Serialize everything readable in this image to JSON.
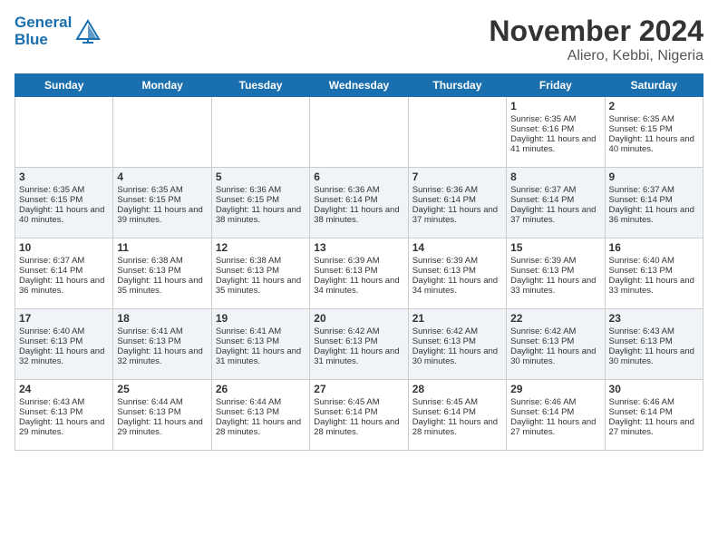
{
  "logo": {
    "line1": "General",
    "line2": "Blue"
  },
  "title": "November 2024",
  "subtitle": "Aliero, Kebbi, Nigeria",
  "days_of_week": [
    "Sunday",
    "Monday",
    "Tuesday",
    "Wednesday",
    "Thursday",
    "Friday",
    "Saturday"
  ],
  "weeks": [
    [
      {
        "day": "",
        "sunrise": "",
        "sunset": "",
        "daylight": ""
      },
      {
        "day": "",
        "sunrise": "",
        "sunset": "",
        "daylight": ""
      },
      {
        "day": "",
        "sunrise": "",
        "sunset": "",
        "daylight": ""
      },
      {
        "day": "",
        "sunrise": "",
        "sunset": "",
        "daylight": ""
      },
      {
        "day": "",
        "sunrise": "",
        "sunset": "",
        "daylight": ""
      },
      {
        "day": "1",
        "sunrise": "Sunrise: 6:35 AM",
        "sunset": "Sunset: 6:16 PM",
        "daylight": "Daylight: 11 hours and 41 minutes."
      },
      {
        "day": "2",
        "sunrise": "Sunrise: 6:35 AM",
        "sunset": "Sunset: 6:15 PM",
        "daylight": "Daylight: 11 hours and 40 minutes."
      }
    ],
    [
      {
        "day": "3",
        "sunrise": "Sunrise: 6:35 AM",
        "sunset": "Sunset: 6:15 PM",
        "daylight": "Daylight: 11 hours and 40 minutes."
      },
      {
        "day": "4",
        "sunrise": "Sunrise: 6:35 AM",
        "sunset": "Sunset: 6:15 PM",
        "daylight": "Daylight: 11 hours and 39 minutes."
      },
      {
        "day": "5",
        "sunrise": "Sunrise: 6:36 AM",
        "sunset": "Sunset: 6:15 PM",
        "daylight": "Daylight: 11 hours and 38 minutes."
      },
      {
        "day": "6",
        "sunrise": "Sunrise: 6:36 AM",
        "sunset": "Sunset: 6:14 PM",
        "daylight": "Daylight: 11 hours and 38 minutes."
      },
      {
        "day": "7",
        "sunrise": "Sunrise: 6:36 AM",
        "sunset": "Sunset: 6:14 PM",
        "daylight": "Daylight: 11 hours and 37 minutes."
      },
      {
        "day": "8",
        "sunrise": "Sunrise: 6:37 AM",
        "sunset": "Sunset: 6:14 PM",
        "daylight": "Daylight: 11 hours and 37 minutes."
      },
      {
        "day": "9",
        "sunrise": "Sunrise: 6:37 AM",
        "sunset": "Sunset: 6:14 PM",
        "daylight": "Daylight: 11 hours and 36 minutes."
      }
    ],
    [
      {
        "day": "10",
        "sunrise": "Sunrise: 6:37 AM",
        "sunset": "Sunset: 6:14 PM",
        "daylight": "Daylight: 11 hours and 36 minutes."
      },
      {
        "day": "11",
        "sunrise": "Sunrise: 6:38 AM",
        "sunset": "Sunset: 6:13 PM",
        "daylight": "Daylight: 11 hours and 35 minutes."
      },
      {
        "day": "12",
        "sunrise": "Sunrise: 6:38 AM",
        "sunset": "Sunset: 6:13 PM",
        "daylight": "Daylight: 11 hours and 35 minutes."
      },
      {
        "day": "13",
        "sunrise": "Sunrise: 6:39 AM",
        "sunset": "Sunset: 6:13 PM",
        "daylight": "Daylight: 11 hours and 34 minutes."
      },
      {
        "day": "14",
        "sunrise": "Sunrise: 6:39 AM",
        "sunset": "Sunset: 6:13 PM",
        "daylight": "Daylight: 11 hours and 34 minutes."
      },
      {
        "day": "15",
        "sunrise": "Sunrise: 6:39 AM",
        "sunset": "Sunset: 6:13 PM",
        "daylight": "Daylight: 11 hours and 33 minutes."
      },
      {
        "day": "16",
        "sunrise": "Sunrise: 6:40 AM",
        "sunset": "Sunset: 6:13 PM",
        "daylight": "Daylight: 11 hours and 33 minutes."
      }
    ],
    [
      {
        "day": "17",
        "sunrise": "Sunrise: 6:40 AM",
        "sunset": "Sunset: 6:13 PM",
        "daylight": "Daylight: 11 hours and 32 minutes."
      },
      {
        "day": "18",
        "sunrise": "Sunrise: 6:41 AM",
        "sunset": "Sunset: 6:13 PM",
        "daylight": "Daylight: 11 hours and 32 minutes."
      },
      {
        "day": "19",
        "sunrise": "Sunrise: 6:41 AM",
        "sunset": "Sunset: 6:13 PM",
        "daylight": "Daylight: 11 hours and 31 minutes."
      },
      {
        "day": "20",
        "sunrise": "Sunrise: 6:42 AM",
        "sunset": "Sunset: 6:13 PM",
        "daylight": "Daylight: 11 hours and 31 minutes."
      },
      {
        "day": "21",
        "sunrise": "Sunrise: 6:42 AM",
        "sunset": "Sunset: 6:13 PM",
        "daylight": "Daylight: 11 hours and 30 minutes."
      },
      {
        "day": "22",
        "sunrise": "Sunrise: 6:42 AM",
        "sunset": "Sunset: 6:13 PM",
        "daylight": "Daylight: 11 hours and 30 minutes."
      },
      {
        "day": "23",
        "sunrise": "Sunrise: 6:43 AM",
        "sunset": "Sunset: 6:13 PM",
        "daylight": "Daylight: 11 hours and 30 minutes."
      }
    ],
    [
      {
        "day": "24",
        "sunrise": "Sunrise: 6:43 AM",
        "sunset": "Sunset: 6:13 PM",
        "daylight": "Daylight: 11 hours and 29 minutes."
      },
      {
        "day": "25",
        "sunrise": "Sunrise: 6:44 AM",
        "sunset": "Sunset: 6:13 PM",
        "daylight": "Daylight: 11 hours and 29 minutes."
      },
      {
        "day": "26",
        "sunrise": "Sunrise: 6:44 AM",
        "sunset": "Sunset: 6:13 PM",
        "daylight": "Daylight: 11 hours and 28 minutes."
      },
      {
        "day": "27",
        "sunrise": "Sunrise: 6:45 AM",
        "sunset": "Sunset: 6:14 PM",
        "daylight": "Daylight: 11 hours and 28 minutes."
      },
      {
        "day": "28",
        "sunrise": "Sunrise: 6:45 AM",
        "sunset": "Sunset: 6:14 PM",
        "daylight": "Daylight: 11 hours and 28 minutes."
      },
      {
        "day": "29",
        "sunrise": "Sunrise: 6:46 AM",
        "sunset": "Sunset: 6:14 PM",
        "daylight": "Daylight: 11 hours and 27 minutes."
      },
      {
        "day": "30",
        "sunrise": "Sunrise: 6:46 AM",
        "sunset": "Sunset: 6:14 PM",
        "daylight": "Daylight: 11 hours and 27 minutes."
      }
    ]
  ]
}
